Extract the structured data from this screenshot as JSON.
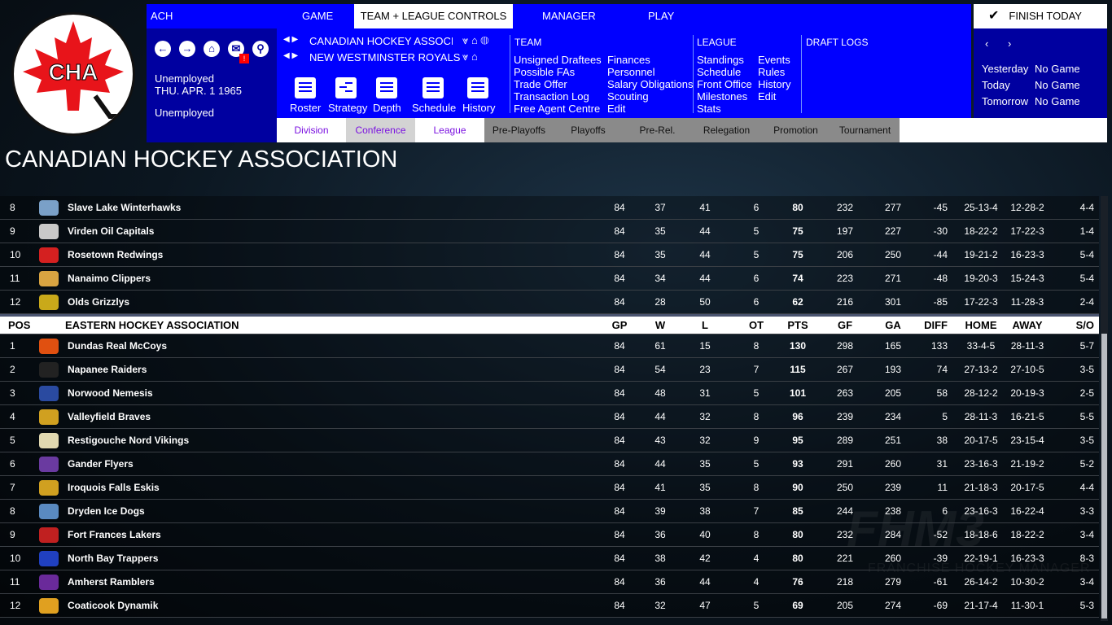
{
  "app": {
    "league_abbr": "ACH",
    "logo_text": "CHA",
    "colors": {
      "primary": "#0000ff",
      "panel": "#0000a0",
      "logo_red": "#e8141a"
    }
  },
  "topnav": {
    "tabs": [
      "GAME",
      "TEAM + LEAGUE CONTROLS",
      "MANAGER",
      "PLAY"
    ],
    "active": "TEAM + LEAGUE CONTROLS",
    "finish": "FINISH TODAY"
  },
  "left_panel": {
    "status": "Unemployed",
    "date": "THU. APR. 1 1965",
    "status2": "Unemployed",
    "alert_badge": "!"
  },
  "selectors": {
    "league": "CANADIAN HOCKEY ASSOCIATI",
    "team": "NEW WESTMINSTER ROYALS"
  },
  "quick_icons": [
    "Roster",
    "Strategy",
    "Depth",
    "Schedule",
    "History"
  ],
  "team_menu": {
    "title": "TEAM",
    "col1": [
      "Unsigned Draftees",
      "Possible FAs",
      "Trade Offer",
      "Transaction Log",
      "Free Agent Centre"
    ],
    "col2": [
      "Finances",
      "Personnel",
      "Salary Obligations",
      "Scouting",
      "Edit"
    ]
  },
  "league_menu": {
    "title": "LEAGUE",
    "col1": [
      "Standings",
      "Schedule",
      "Front Office",
      "Milestones",
      "Stats"
    ],
    "col2": [
      "Events",
      "Rules",
      "History",
      "Edit"
    ]
  },
  "draft_logs": "DRAFT LOGS",
  "games": [
    {
      "day": "Yesterday",
      "value": "No Game"
    },
    {
      "day": "Today",
      "value": "No Game"
    },
    {
      "day": "Tomorrow",
      "value": "No Game"
    }
  ],
  "view_tabs": [
    "Division",
    "Conference",
    "League",
    "Pre-Playoffs",
    "Playoffs",
    "Pre-Rel.",
    "Relegation",
    "Promotion",
    "Tournament"
  ],
  "page_title": "CANADIAN HOCKEY ASSOCIATION",
  "watermark": {
    "logo": "FHM3",
    "tagline": "FRANCHISE HOCKEY MANAGER"
  },
  "columns": [
    "POS",
    "GP",
    "W",
    "L",
    "OT",
    "PTS",
    "GF",
    "GA",
    "DIFF",
    "HOME",
    "AWAY",
    "S/O"
  ],
  "groups": [
    {
      "name": "",
      "rows": [
        [
          "8",
          "Slave Lake Winterhawks",
          "84",
          "37",
          "41",
          "6",
          "80",
          "232",
          "277",
          "-45",
          "25-13-4",
          "12-28-2",
          "4-4",
          "#7aa0c8"
        ],
        [
          "9",
          "Virden Oil Capitals",
          "84",
          "35",
          "44",
          "5",
          "75",
          "197",
          "227",
          "-30",
          "18-22-2",
          "17-22-3",
          "1-4",
          "#c9c9c9"
        ],
        [
          "10",
          "Rosetown Redwings",
          "84",
          "35",
          "44",
          "5",
          "75",
          "206",
          "250",
          "-44",
          "19-21-2",
          "16-23-3",
          "5-4",
          "#d42020"
        ],
        [
          "11",
          "Nanaimo Clippers",
          "84",
          "34",
          "44",
          "6",
          "74",
          "223",
          "271",
          "-48",
          "19-20-3",
          "15-24-3",
          "5-4",
          "#d9a441"
        ],
        [
          "12",
          "Olds Grizzlys",
          "84",
          "28",
          "50",
          "6",
          "62",
          "216",
          "301",
          "-85",
          "17-22-3",
          "11-28-3",
          "2-4",
          "#c9a91a"
        ]
      ]
    },
    {
      "name": "EASTERN HOCKEY ASSOCIATION",
      "rows": [
        [
          "1",
          "Dundas Real McCoys",
          "84",
          "61",
          "15",
          "8",
          "130",
          "298",
          "165",
          "133",
          "33-4-5",
          "28-11-3",
          "5-7",
          "#e05010"
        ],
        [
          "2",
          "Napanee Raiders",
          "84",
          "54",
          "23",
          "7",
          "115",
          "267",
          "193",
          "74",
          "27-13-2",
          "27-10-5",
          "3-5",
          "#222222"
        ],
        [
          "3",
          "Norwood Nemesis",
          "84",
          "48",
          "31",
          "5",
          "101",
          "263",
          "205",
          "58",
          "28-12-2",
          "20-19-3",
          "2-5",
          "#2a4aa0"
        ],
        [
          "4",
          "Valleyfield Braves",
          "84",
          "44",
          "32",
          "8",
          "96",
          "239",
          "234",
          "5",
          "28-11-3",
          "16-21-5",
          "5-5",
          "#d0a020"
        ],
        [
          "5",
          "Restigouche Nord Vikings",
          "84",
          "43",
          "32",
          "9",
          "95",
          "289",
          "251",
          "38",
          "20-17-5",
          "23-15-4",
          "3-5",
          "#e0d8b0"
        ],
        [
          "6",
          "Gander Flyers",
          "84",
          "44",
          "35",
          "5",
          "93",
          "291",
          "260",
          "31",
          "23-16-3",
          "21-19-2",
          "5-2",
          "#6a3aa0"
        ],
        [
          "7",
          "Iroquois Falls Eskis",
          "84",
          "41",
          "35",
          "8",
          "90",
          "250",
          "239",
          "11",
          "21-18-3",
          "20-17-5",
          "4-4",
          "#d0a020"
        ],
        [
          "8",
          "Dryden Ice Dogs",
          "84",
          "39",
          "38",
          "7",
          "85",
          "244",
          "238",
          "6",
          "23-16-3",
          "16-22-4",
          "3-3",
          "#5a8ac0"
        ],
        [
          "9",
          "Fort Frances Lakers",
          "84",
          "36",
          "40",
          "8",
          "80",
          "232",
          "284",
          "-52",
          "18-18-6",
          "18-22-2",
          "3-4",
          "#c02020"
        ],
        [
          "10",
          "North Bay Trappers",
          "84",
          "38",
          "42",
          "4",
          "80",
          "221",
          "260",
          "-39",
          "22-19-1",
          "16-23-3",
          "8-3",
          "#2040c0"
        ],
        [
          "11",
          "Amherst Ramblers",
          "84",
          "36",
          "44",
          "4",
          "76",
          "218",
          "279",
          "-61",
          "26-14-2",
          "10-30-2",
          "3-4",
          "#6a2a9a"
        ],
        [
          "12",
          "Coaticook Dynamik",
          "84",
          "32",
          "47",
          "5",
          "69",
          "205",
          "274",
          "-69",
          "21-17-4",
          "11-30-1",
          "5-3",
          "#e0a020"
        ]
      ]
    }
  ]
}
